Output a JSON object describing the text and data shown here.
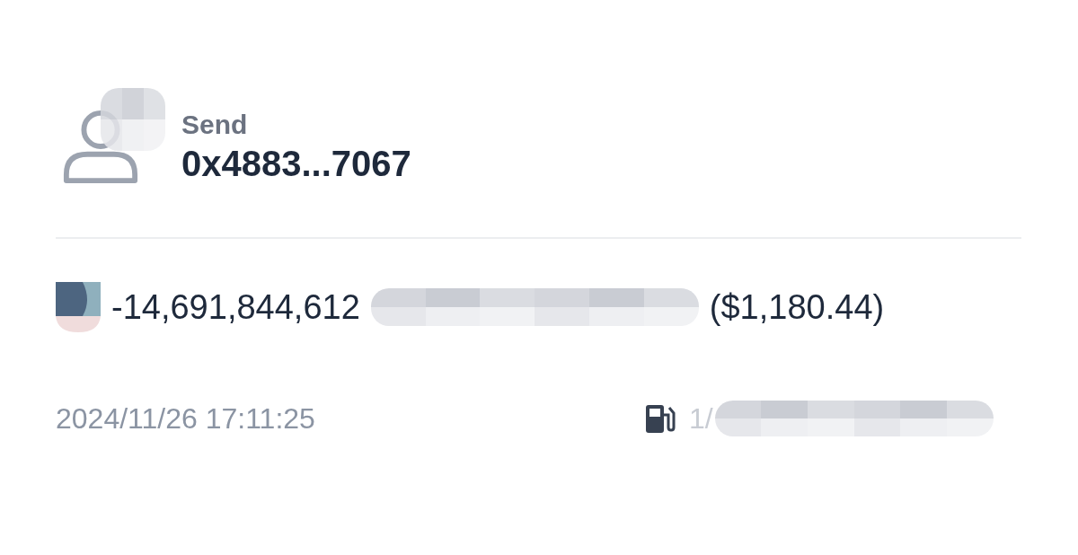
{
  "transaction": {
    "direction": "Send",
    "address": "0x4883...7067",
    "amount": "-14,691,844,612",
    "fiat": "($1,180.44)",
    "time": "2024/11/26 17:11:25",
    "fee": "1/"
  }
}
